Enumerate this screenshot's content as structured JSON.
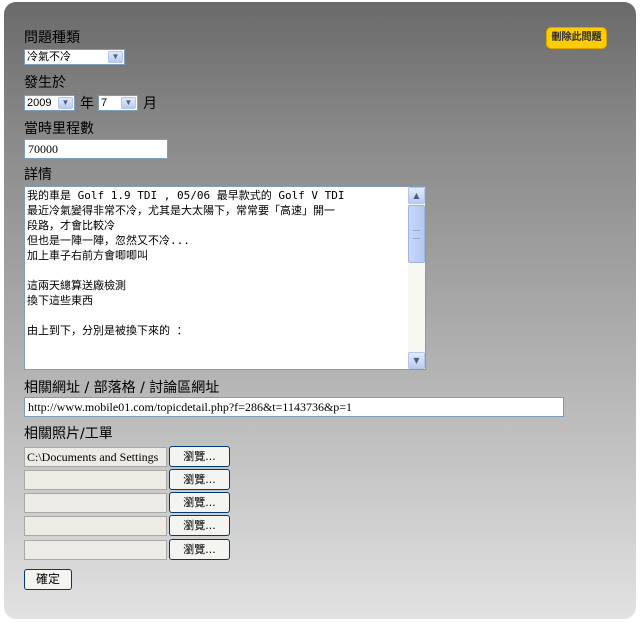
{
  "form": {
    "delete_button": "刪除此問題",
    "problem_type": {
      "label": "問題種類",
      "selected": "冷氣不冷"
    },
    "occurred": {
      "label": "發生於",
      "year": "2009",
      "year_unit": "年",
      "month": "7",
      "month_unit": "月"
    },
    "mileage": {
      "label": "當時里程數",
      "value": "70000"
    },
    "details": {
      "label": "詳情",
      "text": "我的車是 Golf 1.9 TDI , 05/06 最早款式的 Golf V TDI\n最近冷氣變得非常不冷，尤其是大太陽下，常常要「高速」開一\n段路，才會比較冷\n但也是一陣一陣，忽然又不冷...\n加上車子右前方會唧唧叫\n\n這兩天總算送廠檢測\n換下這些東西\n\n由上到下，分別是被換下來的 ："
    },
    "url": {
      "label": "相關網址 / 部落格 / 討論區網址",
      "value": "http://www.mobile01.com/topicdetail.php?f=286&t=1143736&p=1"
    },
    "photos": {
      "label": "相關照片/工單",
      "browse_label": "瀏覽...",
      "files": [
        "C:\\Documents and Settings",
        "",
        "",
        "",
        ""
      ]
    },
    "submit": "確定"
  },
  "icons": {
    "dropdown": "chevron-down-icon",
    "scroll_up": "arrow-up-icon",
    "scroll_down": "arrow-down-icon"
  }
}
